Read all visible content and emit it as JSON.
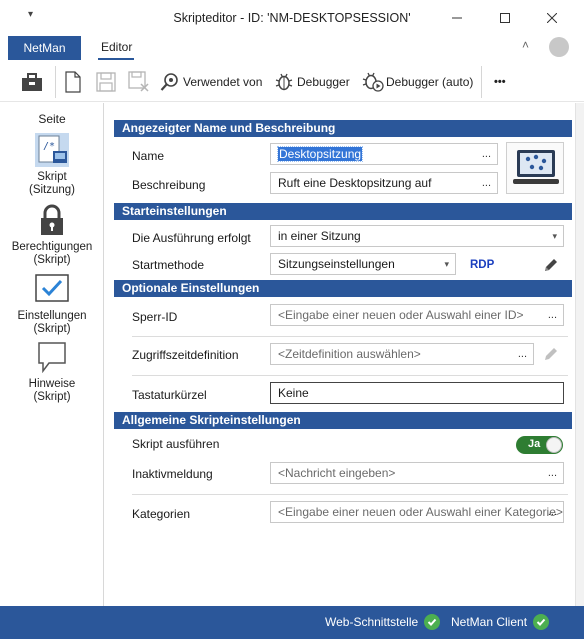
{
  "window": {
    "title": "Skripteditor - ID: 'NM-DESKTOPSESSION'",
    "qa_menu": "▾"
  },
  "ribbon": {
    "app_tab": "NetMan",
    "active_tab": "Editor"
  },
  "toolbar": {
    "used_by": "Verwendet von",
    "debugger": "Debugger",
    "debugger_auto": "Debugger (auto)",
    "more": "•••"
  },
  "sidebar": {
    "header": "Seite",
    "items": [
      {
        "label1": "Skript",
        "label2": "(Sitzung)"
      },
      {
        "label1": "Berechtigungen",
        "label2": "(Skript)"
      },
      {
        "label1": "Einstellungen",
        "label2": "(Skript)"
      },
      {
        "label1": "Hinweise",
        "label2": "(Skript)"
      }
    ]
  },
  "sections": {
    "name_desc": "Angezeigter Name und Beschreibung",
    "start": "Starteinstellungen",
    "optional": "Optionale Einstellungen",
    "general": "Allgemeine Skripteinstellungen"
  },
  "fields": {
    "name_label": "Name",
    "name_value": "Desktopsitzung",
    "desc_label": "Beschreibung",
    "desc_value": "Ruft eine Desktopsitzung auf",
    "exec_label": "Die Ausführung erfolgt",
    "exec_value": "in einer Sitzung",
    "startmethod_label": "Startmethode",
    "startmethod_value": "Sitzungseinstellungen",
    "rdp_label": "RDP",
    "lock_label": "Sperr-ID",
    "lock_placeholder": "<Eingabe einer neuen oder Auswahl einer ID>",
    "access_label": "Zugriffszeitdefinition",
    "access_placeholder": "<Zeitdefinition auswählen>",
    "shortcut_label": "Tastaturkürzel",
    "shortcut_value": "Keine",
    "run_label": "Skript ausführen",
    "run_toggle": "Ja",
    "inactive_label": "Inaktivmeldung",
    "inactive_placeholder": "<Nachricht eingeben>",
    "categories_label": "Kategorien",
    "categories_placeholder": "<Eingabe einer neuen oder Auswahl einer Kategorie>",
    "ellipsis": "..."
  },
  "status": {
    "web": "Web-Schnittstelle",
    "client": "NetMan Client"
  },
  "colors": {
    "accent": "#2b579a",
    "toggle_on": "#2e7d32",
    "status_ok": "#4caf50"
  }
}
